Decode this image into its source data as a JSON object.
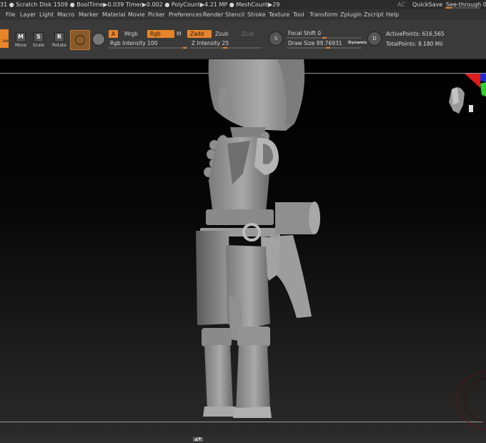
{
  "titlebar": {
    "stats": "31 ● Scratch Disk 1509 ●  BoolTime▶0.039 Timer▶0.002 ● PolyCount▶4.21 MP  ● MeshCount▶29",
    "ac": "AC",
    "quicksave": "QuickSave",
    "see_through": "See-through  0",
    "see_through_value": 0
  },
  "menu": [
    "File",
    "Layer",
    "Light",
    "Macro",
    "Marker",
    "Material",
    "Movie",
    "Picker",
    "Preferences",
    "Render",
    "Stencil",
    "Stroke",
    "Texture",
    "Tool",
    "Transform",
    "Zplugin",
    "Zscript",
    "Help"
  ],
  "toolbar": {
    "draw_label": "aw",
    "move_label": "Move",
    "scale_label": "Scale",
    "rotate_label": "Rotate",
    "a_label": "A",
    "mrgb_label": "Mrgb",
    "rgb_label": "Rgb",
    "m_label": "M",
    "zadd_label": "Zadd",
    "zsub_label": "Zsub",
    "zcut_label": "Zcut",
    "rgb_intensity": "Rgb Intensity 100",
    "z_intensity": "Z Intensity 25",
    "focal_shift": "Focal Shift 0",
    "draw_size": "Draw Size 89.76931",
    "dynamic": "Dynamic",
    "active_points": "ActivePoints: 616,565",
    "total_points": "TotalPoints: 8.180 Mil",
    "s_icon": "S",
    "d_icon": "D"
  },
  "colors": {
    "accent": "#e8842a",
    "toolbar_bg": "#3a3a3a",
    "menubar_bg": "#333333"
  },
  "icons": [
    "draw-icon",
    "move-icon",
    "scale-icon",
    "rotate-icon",
    "brush-icon",
    "stroke-icon",
    "focal-icon",
    "dynamic-icon",
    "navigation-head-icon"
  ]
}
